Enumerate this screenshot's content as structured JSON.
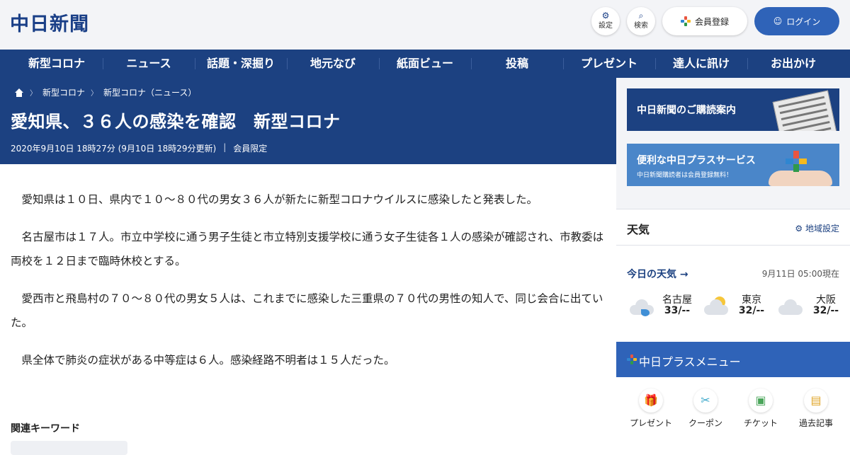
{
  "header": {
    "logo": "中日新聞",
    "settings_label": "設定",
    "search_label": "検索",
    "register_label": "会員登録",
    "login_label": "ログイン"
  },
  "nav": {
    "items": [
      "新型コロナ",
      "ニュース",
      "話題・深掘り",
      "地元なび",
      "紙面ビュー",
      "投稿",
      "プレゼント",
      "達人に訊け",
      "お出かけ"
    ]
  },
  "breadcrumb": {
    "items": [
      "新型コロナ",
      "新型コロナ（ニュース）"
    ]
  },
  "article": {
    "title": "愛知県、３６人の感染を確認　新型コロナ",
    "published": "2020年9月10日 18時27分 (9月10日 18時29分更新)",
    "access": "会員限定",
    "paragraphs": [
      "愛知県は１０日、県内で１０～８０代の男女３６人が新たに新型コロナウイルスに感染したと発表した。",
      "名古屋市は１７人。市立中学校に通う男子生徒と市立特別支援学校に通う女子生徒各１人の感染が確認され、市教委は両校を１２日まで臨時休校とする。",
      "愛西市と飛島村の７０～８０代の男女５人は、これまでに感染した三重県の７０代の男性の知人で、同じ会合に出ていた。",
      "県全体で肺炎の症状がある中等症は６人。感染経路不明者は１５人だった。"
    ],
    "keywords_title": "関連キーワード"
  },
  "sidebar": {
    "banner1": "中日新聞のご購読案内",
    "banner2_title": "便利な中日プラスサービス",
    "banner2_sub": "中日新聞購読者は会員登録無料！",
    "weather_title": "天気",
    "weather_settings": "地域設定",
    "weather_today": "今日の天気 →",
    "weather_time": "9月11日 05:00現在",
    "cities": [
      {
        "name": "名古屋",
        "temp": "33/--",
        "icon": "rain-cloud-icon"
      },
      {
        "name": "東京",
        "temp": "32/--",
        "icon": "sun-cloud-icon"
      },
      {
        "name": "大阪",
        "temp": "32/--",
        "icon": "cloud-icon"
      }
    ],
    "plus_menu_title": "中日プラスメニュー",
    "plus_menu": [
      {
        "label": "プレゼント",
        "icon": "gift-icon"
      },
      {
        "label": "クーポン",
        "icon": "coupon-icon"
      },
      {
        "label": "チケット",
        "icon": "ticket-icon"
      },
      {
        "label": "過去記事",
        "icon": "archive-icon"
      }
    ]
  }
}
